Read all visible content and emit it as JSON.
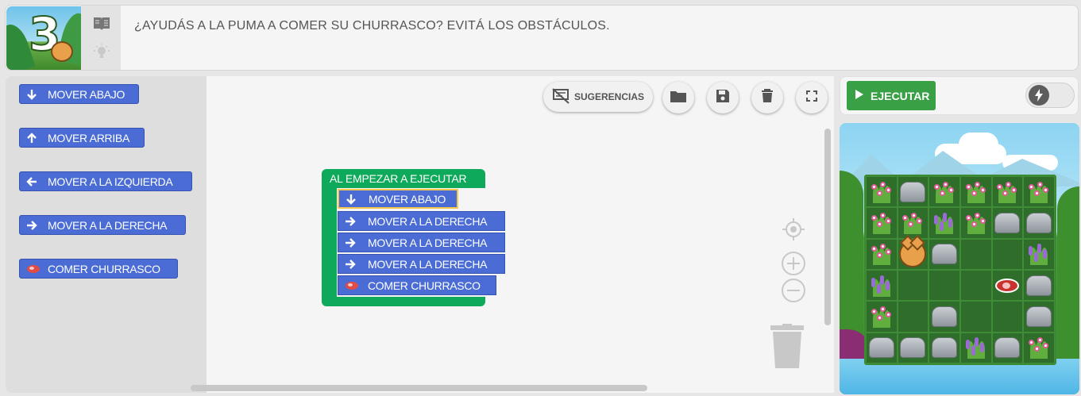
{
  "header": {
    "level_number": "3",
    "statement": "¿AYUDÁS A LA PUMA A COMER SU CHURRASCO? EVITÁ LOS OBSTÁCULOS."
  },
  "toolbox": {
    "blocks": [
      {
        "label": "MOVER ABAJO",
        "icon": "arrow-down-icon"
      },
      {
        "label": "MOVER ARRIBA",
        "icon": "arrow-up-icon"
      },
      {
        "label": "MOVER A LA IZQUIERDA",
        "icon": "arrow-left-icon"
      },
      {
        "label": "MOVER A LA DERECHA",
        "icon": "arrow-right-icon"
      },
      {
        "label": "COMER CHURRASCO",
        "icon": "steak-icon"
      }
    ]
  },
  "workspace": {
    "suggestions_label": "SUGERENCIAS",
    "event_label": "AL EMPEZAR A EJECUTAR",
    "program": [
      {
        "label": "MOVER ABAJO",
        "icon": "arrow-down-icon",
        "selected": true
      },
      {
        "label": "MOVER A LA DERECHA",
        "icon": "arrow-right-icon"
      },
      {
        "label": "MOVER A LA DERECHA",
        "icon": "arrow-right-icon"
      },
      {
        "label": "MOVER A LA DERECHA",
        "icon": "arrow-right-icon"
      },
      {
        "label": "COMER CHURRASCO",
        "icon": "steak-icon"
      }
    ]
  },
  "run_panel": {
    "run_label": "EJECUTAR",
    "turbo_toggle": "off"
  },
  "scene": {
    "grid": [
      [
        "bush",
        "rock",
        "bush",
        "bush",
        "bush",
        "bush"
      ],
      [
        "bush",
        "bush",
        "lavender",
        "bush",
        "rock",
        "rock"
      ],
      [
        "bush",
        "cat",
        "rock",
        "empty",
        "empty",
        "lavender"
      ],
      [
        "lavender",
        "empty",
        "empty",
        "empty",
        "steak",
        "rock"
      ],
      [
        "bush",
        "empty",
        "rock",
        "empty",
        "empty",
        "rock"
      ],
      [
        "rock",
        "rock",
        "rock",
        "lavender",
        "rock",
        "bush"
      ]
    ]
  },
  "colors": {
    "block_blue": "#4a6cd4",
    "event_green": "#0ea95a",
    "run_green": "#39a045",
    "selected_outline": "#f2c94c"
  }
}
